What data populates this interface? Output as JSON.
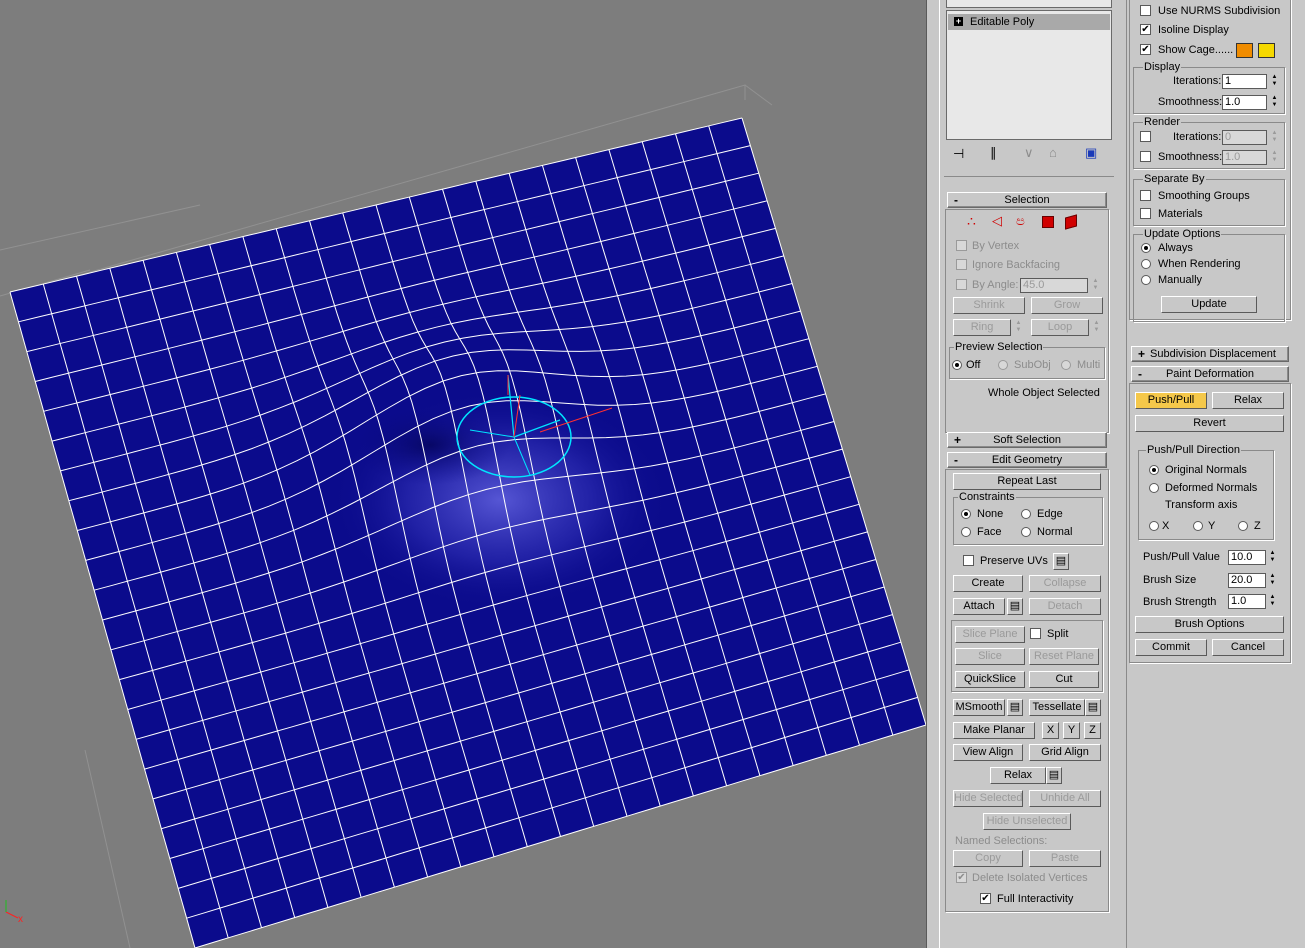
{
  "stack": {
    "item": "Editable Poly"
  },
  "selection": {
    "title": "Selection",
    "by_vertex": "By Vertex",
    "ignore_backfacing": "Ignore Backfacing",
    "by_angle": "By Angle:",
    "by_angle_value": "45.0",
    "shrink": "Shrink",
    "grow": "Grow",
    "ring": "Ring",
    "loop": "Loop",
    "preview_label": "Preview Selection",
    "off": "Off",
    "subobj": "SubObj",
    "multi": "Multi",
    "status": "Whole Object Selected"
  },
  "soft_selection": {
    "title": "Soft Selection"
  },
  "edit_geometry": {
    "title": "Edit Geometry",
    "repeat_last": "Repeat Last",
    "constraints": "Constraints",
    "none": "None",
    "edge": "Edge",
    "face": "Face",
    "normal": "Normal",
    "preserve_uvs": "Preserve UVs",
    "create": "Create",
    "collapse": "Collapse",
    "attach": "Attach",
    "detach": "Detach",
    "slice_plane": "Slice Plane",
    "split": "Split",
    "slice": "Slice",
    "reset_plane": "Reset Plane",
    "quickslice": "QuickSlice",
    "cut": "Cut",
    "msmooth": "MSmooth",
    "tessellate": "Tessellate",
    "make_planar": "Make Planar",
    "x": "X",
    "y": "Y",
    "z": "Z",
    "view_align": "View Align",
    "grid_align": "Grid Align",
    "relax": "Relax",
    "hide_selected": "Hide Selected",
    "unhide_all": "Unhide All",
    "hide_unselected": "Hide Unselected",
    "named_selections": "Named Selections:",
    "copy": "Copy",
    "paste": "Paste",
    "delete_isolated": "Delete Isolated Vertices",
    "full_interactivity": "Full Interactivity"
  },
  "subdivision": {
    "use_nurms": "Use NURMS Subdivision",
    "isoline": "Isoline Display",
    "show_cage": "Show Cage......",
    "cage_color_1": "#f08c00",
    "cage_color_2": "#f5d800",
    "display": "Display",
    "iterations": "Iterations:",
    "iterations_value": "1",
    "smoothness": "Smoothness:",
    "smoothness_value": "1.0",
    "render": "Render",
    "render_iterations_value": "0",
    "render_smoothness_value": "1.0",
    "separate_by": "Separate By",
    "smoothing_groups": "Smoothing Groups",
    "materials": "Materials",
    "update_options": "Update Options",
    "always": "Always",
    "when_rendering": "When Rendering",
    "manually": "Manually",
    "update": "Update"
  },
  "subdivision_displacement": {
    "title": "Subdivision Displacement"
  },
  "paint_deformation": {
    "title": "Paint Deformation",
    "push_pull": "Push/Pull",
    "relax": "Relax",
    "revert": "Revert",
    "direction": "Push/Pull Direction",
    "original_normals": "Original Normals",
    "deformed_normals": "Deformed Normals",
    "transform_axis": "Transform axis",
    "x": "X",
    "y": "Y",
    "z": "Z",
    "push_pull_value": "Push/Pull Value",
    "push_pull_value_num": "10.0",
    "brush_size": "Brush Size",
    "brush_size_num": "20.0",
    "brush_strength": "Brush Strength",
    "brush_strength_num": "1.0",
    "brush_options": "Brush Options",
    "commit": "Commit",
    "cancel": "Cancel"
  },
  "viewport": {
    "plane_color": "#0b0b8c",
    "wire_color": "#ffffff",
    "gizmo_color": "#00e5ff"
  }
}
